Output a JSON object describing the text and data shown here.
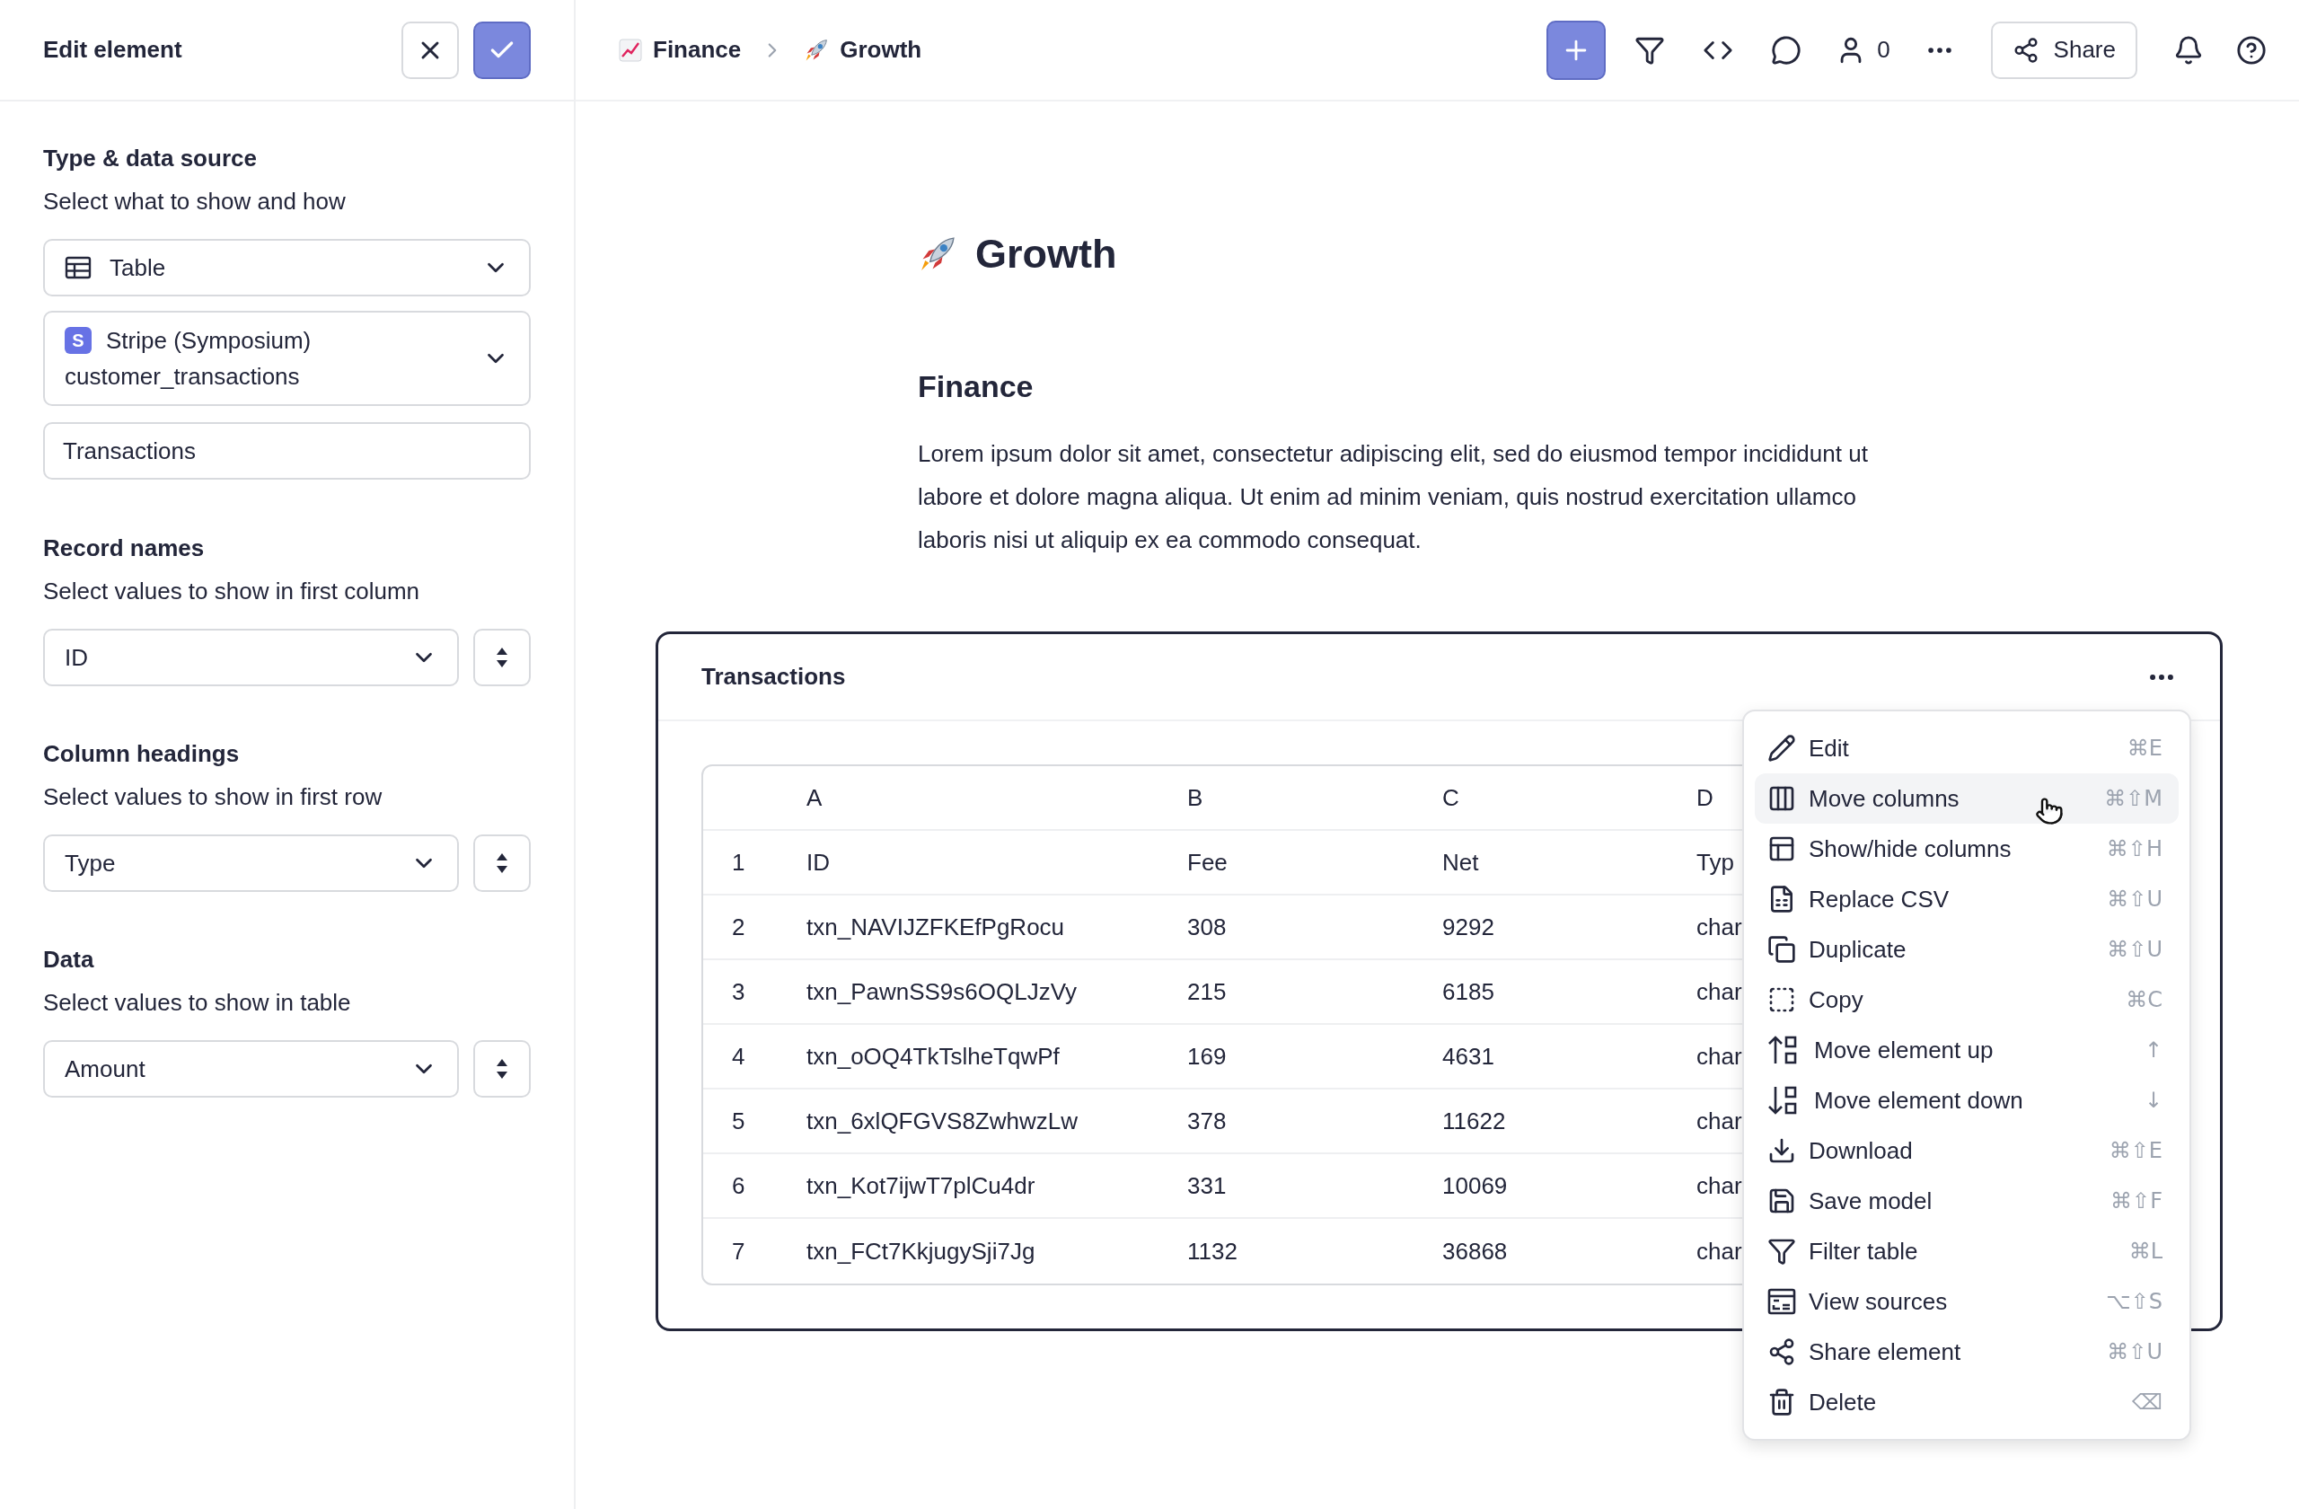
{
  "edit_panel": {
    "title": "Edit element",
    "type_section": {
      "title": "Type & data source",
      "subtitle": "Select what to show and how",
      "type_select": "Table",
      "source_select": {
        "badge": "S",
        "name": "Stripe (Symposium)",
        "table": "customer_transactions"
      },
      "name_field": "Transactions"
    },
    "value_sections": [
      {
        "title": "Record names",
        "subtitle": "Select values to show in first column",
        "value": "ID"
      },
      {
        "title": "Column headings",
        "subtitle": "Select values to show in first row",
        "value": "Type"
      },
      {
        "title": "Data",
        "subtitle": "Select values to show in table",
        "value": "Amount"
      }
    ]
  },
  "breadcrumbs": [
    {
      "kind": "chart",
      "label": "Finance"
    },
    {
      "kind": "rocket",
      "label": "Growth"
    }
  ],
  "toolbar": {
    "people_count": "0",
    "share": "Share"
  },
  "document": {
    "title": "Growth",
    "heading": "Finance",
    "paragraph": "Lorem ipsum dolor sit amet, consectetur adipiscing elit, sed do eiusmod tempor incididunt ut labore et dolore magna aliqua. Ut enim ad minim veniam, quis nostrud exercitation ullamco laboris nisi ut aliquip ex ea commodo consequat."
  },
  "table_card": {
    "title": "Transactions",
    "columns": [
      "A",
      "B",
      "C",
      "D"
    ],
    "rows": [
      {
        "number": "1",
        "cells": [
          "ID",
          "Fee",
          "Net",
          "Typ"
        ]
      },
      {
        "number": "2",
        "cells": [
          "txn_NAVIJZFKEfPgRocu",
          "308",
          "9292",
          "char"
        ]
      },
      {
        "number": "3",
        "cells": [
          "txn_PawnSS9s6OQLJzVy",
          "215",
          "6185",
          "char"
        ]
      },
      {
        "number": "4",
        "cells": [
          "txn_oOQ4TkTslheTqwPf",
          "169",
          "4631",
          "char"
        ]
      },
      {
        "number": "5",
        "cells": [
          "txn_6xlQFGVS8ZwhwzLw",
          "378",
          "11622",
          "char"
        ]
      },
      {
        "number": "6",
        "cells": [
          "txn_Kot7ijwT7plCu4dr",
          "331",
          "10069",
          "char"
        ]
      },
      {
        "number": "7",
        "cells": [
          "txn_FCt7KkjugySji7Jg",
          "1132",
          "36868",
          "char"
        ]
      }
    ]
  },
  "context_menu": {
    "items": [
      {
        "label": "Edit",
        "shortcut": "⌘E",
        "selected": false
      },
      {
        "label": "Move columns",
        "shortcut": "⌘⇧M",
        "selected": true
      },
      {
        "label": "Show/hide columns",
        "shortcut": "⌘⇧H",
        "selected": false
      },
      {
        "label": "Replace CSV",
        "shortcut": "⌘⇧U",
        "selected": false
      },
      {
        "label": "Duplicate",
        "shortcut": "⌘⇧U",
        "selected": false
      },
      {
        "label": "Copy",
        "shortcut": "⌘C",
        "selected": false
      },
      {
        "label": "Move element up",
        "shortcut": "↑",
        "selected": false
      },
      {
        "label": "Move element down",
        "shortcut": "↓",
        "selected": false
      },
      {
        "label": "Download",
        "shortcut": "⌘⇧E",
        "selected": false
      },
      {
        "label": "Save model",
        "shortcut": "⌘⇧F",
        "selected": false
      },
      {
        "label": "Filter table",
        "shortcut": "⌘L",
        "selected": false
      },
      {
        "label": "View sources",
        "shortcut": "⌥⇧S",
        "selected": false
      },
      {
        "label": "Share element",
        "shortcut": "⌘⇧U",
        "selected": false
      },
      {
        "label": "Delete",
        "shortcut": "⌫",
        "selected": false
      }
    ]
  }
}
